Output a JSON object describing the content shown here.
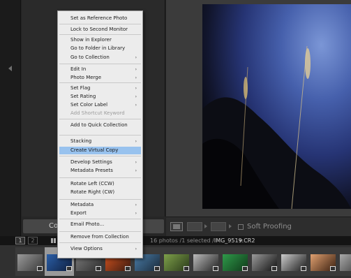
{
  "context_menu": {
    "items": [
      {
        "label": "Set as Reference Photo",
        "submenu": false,
        "disabled": false,
        "highlight": false
      },
      {
        "label": "Lock to Second Monitor",
        "submenu": false,
        "disabled": false,
        "highlight": false
      },
      {
        "label": "Show in Explorer",
        "submenu": false,
        "disabled": false,
        "highlight": false
      },
      {
        "label": "Go to Folder in Library",
        "submenu": false,
        "disabled": false,
        "highlight": false
      },
      {
        "label": "Go to Collection",
        "submenu": true,
        "disabled": false,
        "highlight": false
      },
      {
        "label": "Edit In",
        "submenu": true,
        "disabled": false,
        "highlight": false
      },
      {
        "label": "Photo Merge",
        "submenu": true,
        "disabled": false,
        "highlight": false
      },
      {
        "label": "Set Flag",
        "submenu": true,
        "disabled": false,
        "highlight": false
      },
      {
        "label": "Set Rating",
        "submenu": true,
        "disabled": false,
        "highlight": false
      },
      {
        "label": "Set Color Label",
        "submenu": true,
        "disabled": false,
        "highlight": false
      },
      {
        "label": "Add Shortcut Keyword",
        "submenu": false,
        "disabled": true,
        "highlight": false
      },
      {
        "label": "Add to Quick Collection",
        "submenu": false,
        "disabled": false,
        "highlight": false
      },
      {
        "label": "Stacking",
        "submenu": true,
        "disabled": false,
        "highlight": false
      },
      {
        "label": "Create Virtual Copy",
        "submenu": false,
        "disabled": false,
        "highlight": true
      },
      {
        "label": "Develop Settings",
        "submenu": true,
        "disabled": false,
        "highlight": false
      },
      {
        "label": "Metadata Presets",
        "submenu": true,
        "disabled": false,
        "highlight": false
      },
      {
        "label": "Rotate Left (CCW)",
        "submenu": false,
        "disabled": false,
        "highlight": false
      },
      {
        "label": "Rotate Right (CW)",
        "submenu": false,
        "disabled": false,
        "highlight": false
      },
      {
        "label": "Metadata",
        "submenu": true,
        "disabled": false,
        "highlight": false
      },
      {
        "label": "Export",
        "submenu": true,
        "disabled": false,
        "highlight": false
      },
      {
        "label": "Email Photo...",
        "submenu": false,
        "disabled": false,
        "highlight": false
      },
      {
        "label": "Remove from Collection",
        "submenu": false,
        "disabled": false,
        "highlight": false
      },
      {
        "label": "View Options",
        "submenu": true,
        "disabled": false,
        "highlight": false
      }
    ],
    "submenu_glyph": "›"
  },
  "nav_button_label": "Co",
  "toolbar": {
    "soft_proofing_label": "Soft Proofing"
  },
  "filmstrip_bar": {
    "monitor_1": "1",
    "monitor_2": "2",
    "info_prefix": "16 photos /1 selected /",
    "filename": "IMG_9519.CR2"
  },
  "filmstrip": {
    "thumbnails": [
      {
        "colors": [
          "#9a9a9a",
          "#3a3a3a"
        ],
        "selected": false
      },
      {
        "colors": [
          "#2b5fa8",
          "#0f1f3f"
        ],
        "selected": true
      },
      {
        "colors": [
          "#7a7a7a",
          "#2e2e2e"
        ],
        "selected": false
      },
      {
        "colors": [
          "#d0521f",
          "#3a1a10"
        ],
        "selected": false
      },
      {
        "colors": [
          "#4a7da8",
          "#1a2a3a"
        ],
        "selected": false
      },
      {
        "colors": [
          "#7ea04a",
          "#2a3a1a"
        ],
        "selected": false
      },
      {
        "colors": [
          "#bbbbbb",
          "#222222"
        ],
        "selected": false
      },
      {
        "colors": [
          "#2f9a4a",
          "#103a1a"
        ],
        "selected": false
      },
      {
        "colors": [
          "#9a9a9a",
          "#111111"
        ],
        "selected": false
      },
      {
        "colors": [
          "#cccccc",
          "#1a1a1a"
        ],
        "selected": false
      },
      {
        "colors": [
          "#e0a070",
          "#3a2010"
        ],
        "selected": false
      },
      {
        "colors": [
          "#aaaaaa",
          "#333333"
        ],
        "selected": false
      }
    ]
  }
}
